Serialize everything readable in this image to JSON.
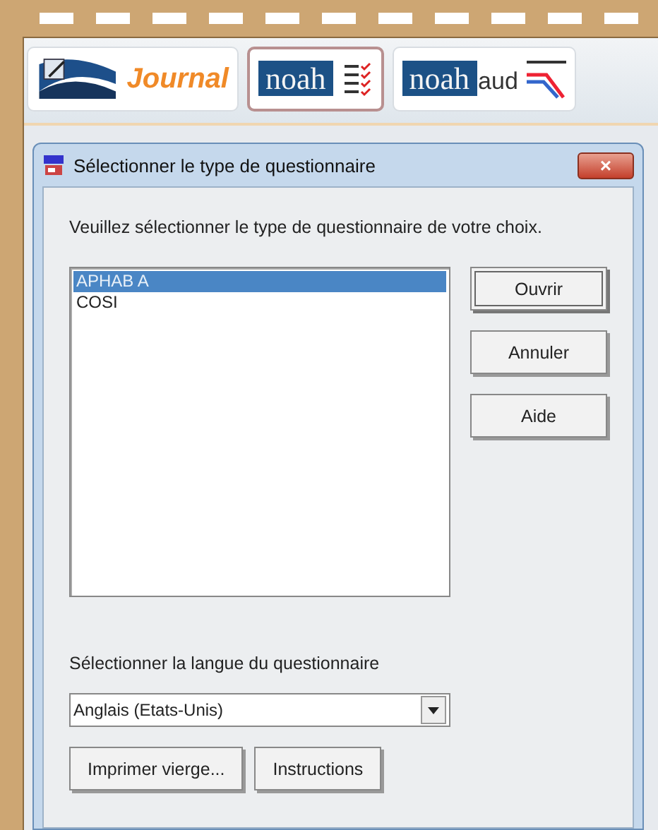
{
  "modules": [
    {
      "kind": "journal",
      "label": "Journal",
      "selected": false
    },
    {
      "kind": "checklist",
      "label": "noah",
      "selected": true
    },
    {
      "kind": "audiogram",
      "label": "noah",
      "suffix": "aud",
      "selected": false
    }
  ],
  "dialog": {
    "title": "Sélectionner le type de questionnaire",
    "close": "×",
    "prompt": "Veuillez sélectionner le type de questionnaire de votre choix.",
    "questionnaires": [
      {
        "label": "APHAB A",
        "selected": true
      },
      {
        "label": "COSI",
        "selected": false
      }
    ],
    "side_buttons": [
      {
        "label": "Ouvrir",
        "default": true
      },
      {
        "label": "Annuler",
        "default": false
      },
      {
        "label": "Aide",
        "default": false
      }
    ],
    "language_label": "Sélectionner la langue du questionnaire",
    "language": "Anglais (Etats-Unis)",
    "bottom_buttons": [
      "Imprimer vierge...",
      "Instructions"
    ]
  }
}
